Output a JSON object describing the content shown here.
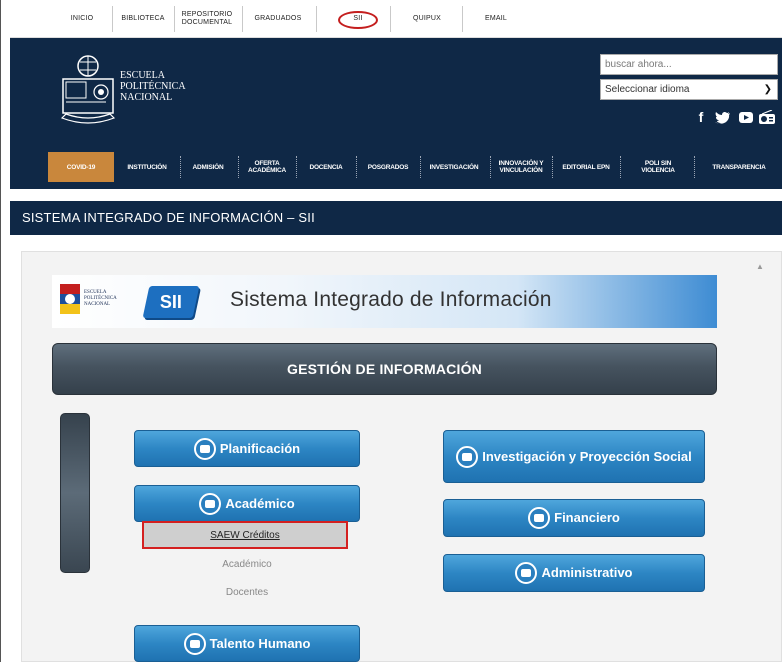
{
  "top_links": [
    {
      "label": "INICIO"
    },
    {
      "label": "BIBLIOTECA"
    },
    {
      "label": "REPOSITORIO DOCUMENTAL"
    },
    {
      "label": "GRADUADOS"
    },
    {
      "label": "SII"
    },
    {
      "label": "QUIPUX"
    },
    {
      "label": "EMAIL"
    }
  ],
  "header": {
    "logo_text_lines": [
      "ESCUELA",
      "POLITÉCNICA",
      "NACIONAL"
    ],
    "search_placeholder": "buscar ahora...",
    "language_select": "Seleccionar idioma",
    "social_icons": [
      "facebook-icon",
      "twitter-icon",
      "youtube-icon",
      "radio-icon"
    ]
  },
  "nav": [
    {
      "label": "COVID-19",
      "active": true
    },
    {
      "label": "INSTITUCIÓN"
    },
    {
      "label": "ADMISIÓN"
    },
    {
      "label": "OFERTA ACADÉMICA"
    },
    {
      "label": "DOCENCIA"
    },
    {
      "label": "POSGRADOS"
    },
    {
      "label": "INVESTIGACIÓN"
    },
    {
      "label": "INNOVACIÓN Y VINCULACIÓN"
    },
    {
      "label": "EDITORIAL EPN"
    },
    {
      "label": "POLI SIN VIOLENCIA"
    },
    {
      "label": "TRANSPARENCIA"
    }
  ],
  "page_title": "SISTEMA INTEGRADO DE INFORMACIÓN – SII",
  "banner": {
    "small_logo_lines": [
      "ESCUELA",
      "POLITÉCNICA",
      "NACIONAL"
    ],
    "badge": "SII",
    "title": "Sistema Integrado de Información"
  },
  "gestion_title": "GESTIÓN DE INFORMACIÓN",
  "modules": {
    "planificacion": "Planificación",
    "academico": "Académico",
    "talento_humano": "Talento Humano",
    "investigacion": "Investigación y Proyección Social",
    "financiero": "Financiero",
    "administrativo": "Administrativo"
  },
  "academico_submenu": {
    "saew": "SAEW Créditos",
    "academico": "Académico",
    "docentes": "Docentes"
  },
  "colors": {
    "header_bg": "#0f2846",
    "active_nav": "#c9873c",
    "button_blue": "#2d86c4",
    "highlight_red": "#d42020"
  }
}
